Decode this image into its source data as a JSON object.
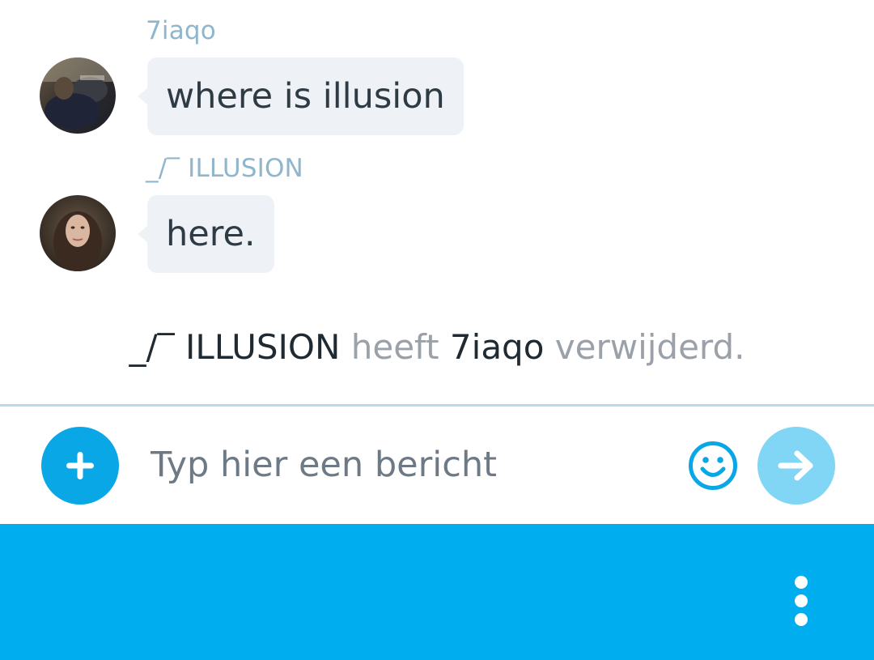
{
  "messages": [
    {
      "sender": "7iaqo",
      "text": "where is illusion",
      "avatar": "avatar-7iaqo"
    },
    {
      "sender": "_/‾ ILLUSION",
      "text": "here.",
      "avatar": "avatar-illusion"
    }
  ],
  "system_message": {
    "actor": "_/‾ ILLUSION",
    "verb": "heeft",
    "target": "7iaqo",
    "action": "verwijderd."
  },
  "composer": {
    "placeholder": "Typ hier een bericht",
    "value": "",
    "add_icon": "plus-icon",
    "emoji_icon": "smiley-icon",
    "send_icon": "arrow-right-icon"
  },
  "bottom_bar": {
    "menu_icon": "more-vertical-icon"
  },
  "colors": {
    "accent": "#00aeef",
    "bubble": "#eef2f7",
    "sender_name": "#8fb6cc",
    "send_disabled": "#82d6f5"
  }
}
